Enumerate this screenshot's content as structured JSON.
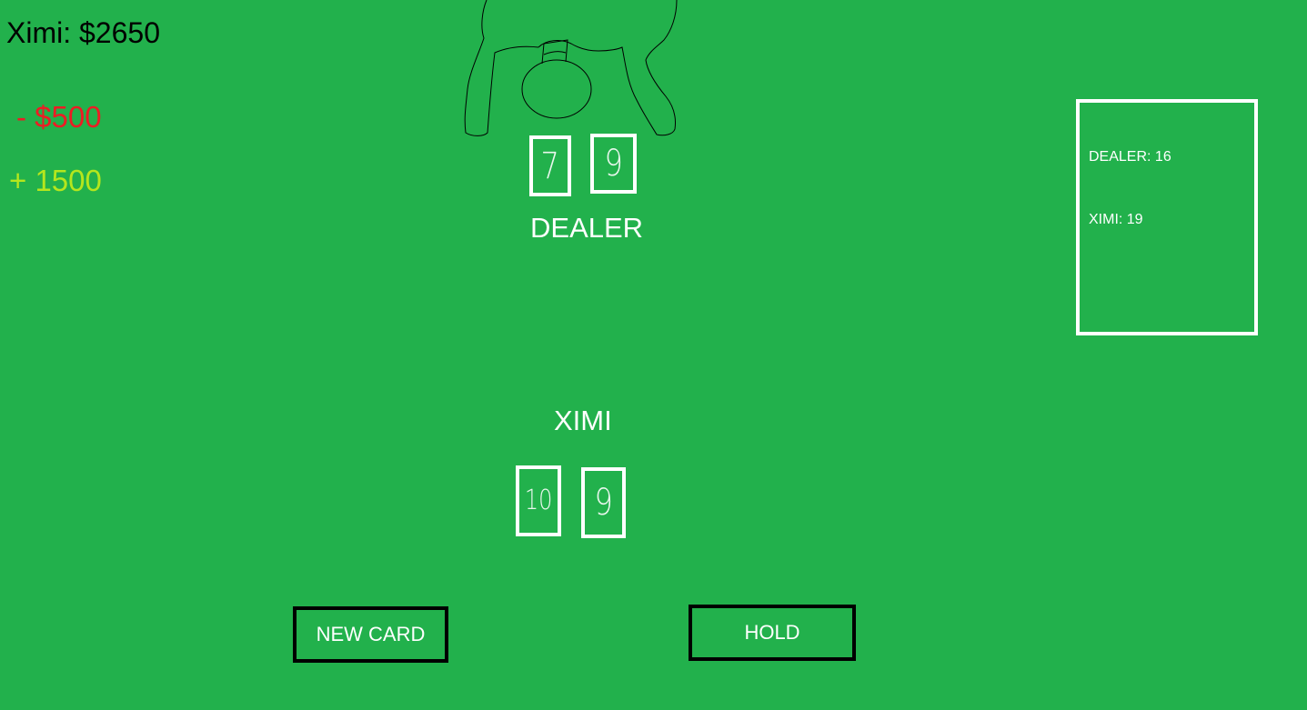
{
  "player": {
    "balance_text": "Ximi: $2650",
    "loss_text": " - $500",
    "gain_text": "+ 1500"
  },
  "dealer": {
    "label": "DEALER",
    "cards": [
      "7",
      "9"
    ]
  },
  "hand": {
    "label": "XIMI",
    "cards": [
      "10",
      "9"
    ]
  },
  "scoreboard": {
    "dealer_score": "DEALER: 16",
    "player_score": "XIMI: 19"
  },
  "actions": {
    "new_card_label": "NEW CARD",
    "hold_label": "HOLD"
  },
  "colors": {
    "table_green": "#22b14c",
    "loss_red": "#ed1c24",
    "gain_lime": "#b5e61d",
    "card_outline": "#ffffff"
  },
  "icons": {
    "dealer_figure": "dealer-figure-icon"
  }
}
